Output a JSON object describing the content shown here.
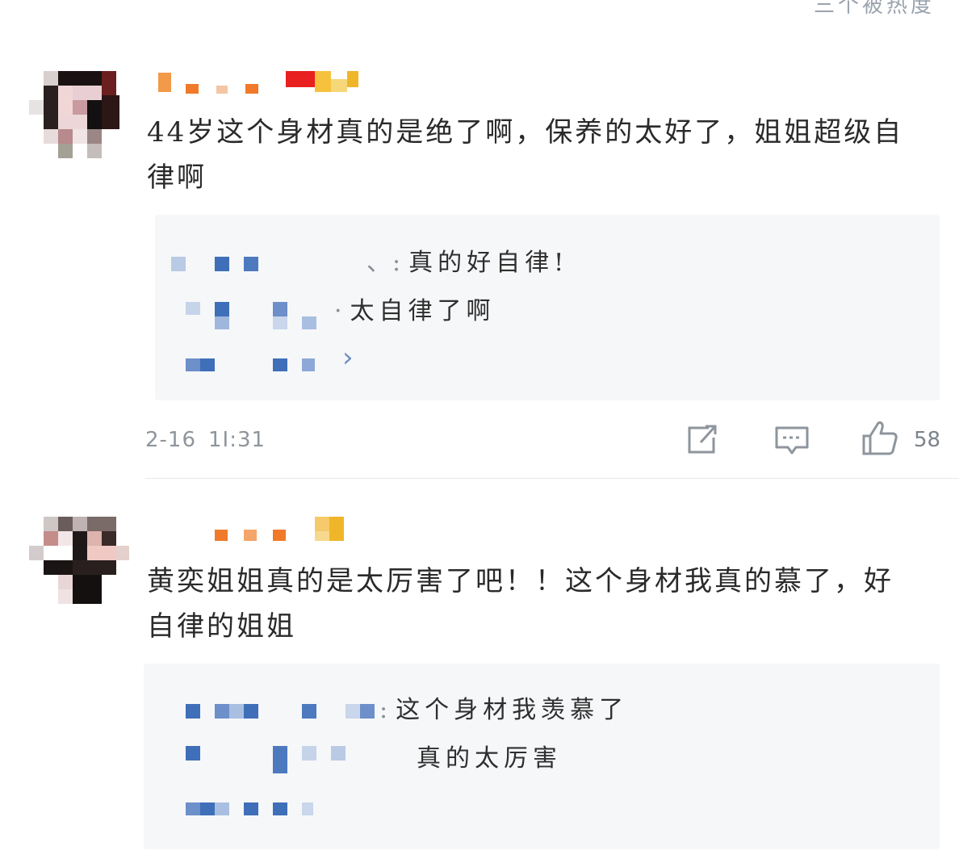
{
  "header": {
    "hint_text": "三个被热度"
  },
  "comments": [
    {
      "text": "44岁这个身材真的是绝了啊，保养的太好了，姐姐超级自律啊",
      "replies": [
        {
          "prefix": "、:",
          "text": "真的好自律!"
        },
        {
          "prefix": "·",
          "text": "太自律了啊"
        }
      ],
      "more_replies_icon": "chevron-right-icon",
      "date": "2-16",
      "time": "1І:31",
      "actions": {
        "share_icon": "share-icon",
        "comment_icon": "comment-icon",
        "like_icon": "thumbs-up-icon",
        "like_count": "58"
      }
    },
    {
      "text": "黄奕姐姐真的是太厉害了吧！！这个身材我真的慕了，好自律的姐姐",
      "replies": [
        {
          "prefix": ":",
          "text": "这个身材我羡慕了"
        },
        {
          "prefix": "",
          "text": "真的太厉害"
        }
      ]
    }
  ],
  "colors": {
    "reply_bg": "#f6f7f9",
    "pixel_blue": "#4a74b8",
    "pixel_orange": "#f07a2a",
    "meta_gray": "#8e959c"
  }
}
